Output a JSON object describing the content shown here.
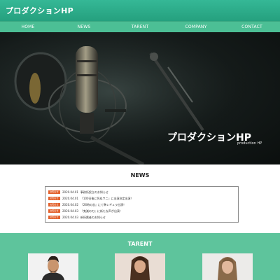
{
  "header": {
    "title": "プロダクションHP"
  },
  "nav": {
    "items": [
      {
        "label": "HOME"
      },
      {
        "label": "NEWS"
      },
      {
        "label": "TARENT"
      },
      {
        "label": "COMPANY"
      },
      {
        "label": "CONTACT"
      }
    ]
  },
  "hero": {
    "title": "プロダクションHP",
    "subtitle": "production HP"
  },
  "news": {
    "heading": "NEWS",
    "items": [
      {
        "badge": "お知らせ",
        "date": "2020.04.01",
        "text": "事務所設立のお知らせ"
      },
      {
        "badge": "お知らせ",
        "date": "2020.04.01",
        "text": "『100日後に死ぬワニ』に出演決定出演！"
      },
      {
        "badge": "お知らせ",
        "date": "2020.04.02",
        "text": "『26時の恋』にて準レギュラ出演！"
      },
      {
        "badge": "お知らせ",
        "date": "2020.04.03",
        "text": "『鬼滅の刃』に新たな声が出演！"
      },
      {
        "badge": "お知らせ",
        "date": "2020.04.03",
        "text": "新所属者のお知らせ"
      }
    ]
  },
  "tarent": {
    "heading": "TARENT"
  },
  "colors": {
    "header": "#2aab87",
    "nav": "#4cbf95",
    "badge": "#e3622e",
    "tarent_bg": "#5ec49c"
  }
}
